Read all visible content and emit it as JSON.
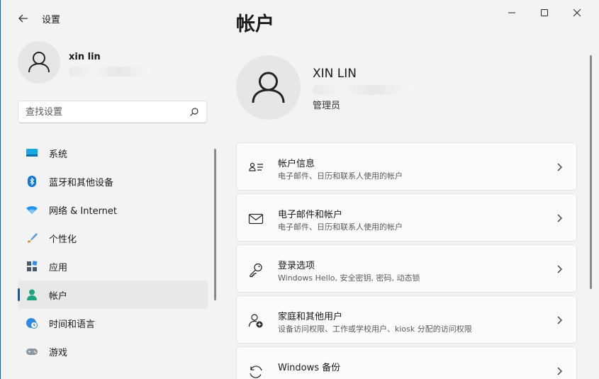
{
  "app": {
    "title": "设置"
  },
  "profile": {
    "name": "xin lin"
  },
  "search": {
    "placeholder": "查找设置"
  },
  "nav": {
    "items": [
      {
        "id": "system",
        "label": "系统",
        "icon": "monitor-icon",
        "active": false
      },
      {
        "id": "bluetooth",
        "label": "蓝牙和其他设备",
        "icon": "bluetooth-icon",
        "active": false
      },
      {
        "id": "network",
        "label": "网络 & Internet",
        "icon": "wifi-icon",
        "active": false
      },
      {
        "id": "personalization",
        "label": "个性化",
        "icon": "brush-icon",
        "active": false
      },
      {
        "id": "apps",
        "label": "应用",
        "icon": "apps-icon",
        "active": false
      },
      {
        "id": "accounts",
        "label": "帐户",
        "icon": "person-icon",
        "active": true
      },
      {
        "id": "time-language",
        "label": "时间和语言",
        "icon": "globe-clock-icon",
        "active": false
      },
      {
        "id": "gaming",
        "label": "游戏",
        "icon": "gamepad-icon",
        "active": false
      }
    ]
  },
  "main": {
    "title": "帐户",
    "account": {
      "name": "XIN LIN",
      "role": "管理员"
    },
    "cards": [
      {
        "id": "your-info",
        "title": "帐户信息",
        "subtitle": "电子邮件、日历和联系人使用的帐户",
        "icon": "id-card-icon"
      },
      {
        "id": "email-accounts",
        "title": "电子邮件和帐户",
        "subtitle": "电子邮件、日历和联系人使用的帐户",
        "icon": "mail-icon"
      },
      {
        "id": "sign-in-options",
        "title": "登录选项",
        "subtitle": "Windows Hello, 安全密钥, 密码, 动态锁",
        "icon": "key-icon"
      },
      {
        "id": "family-users",
        "title": "家庭和其他用户",
        "subtitle": "设备访问权限、工作或学校用户、kiosk 分配的访问权限",
        "icon": "person-add-icon"
      },
      {
        "id": "windows-backup",
        "title": "Windows 备份",
        "subtitle": "",
        "icon": "backup-icon"
      }
    ]
  },
  "colors": {
    "accent": "#005fb8",
    "background": "#f3f3f3",
    "card": "#fbfbfb"
  }
}
